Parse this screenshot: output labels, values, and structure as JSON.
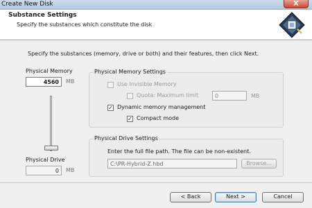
{
  "window": {
    "title": "Create New Disk",
    "close_label": "X"
  },
  "header": {
    "title": "Substance Settings",
    "subtitle": "Specify the substances which constitute the disk",
    "icon": "disk-icon"
  },
  "intro": "Specify the substances (memory, drive or both) and their features, then click Next.",
  "left": {
    "memory_label": "Physical Memory",
    "memory_value": "4560",
    "memory_unit": "MB",
    "drive_label": "Physical Drive",
    "drive_value": "0",
    "drive_unit": "MB"
  },
  "memory_settings": {
    "title": "Physical Memory Settings",
    "use_invisible": {
      "label": "Use Invisible Memory",
      "checked": false,
      "enabled": false
    },
    "quota": {
      "label": "Quota: Maximum limit",
      "checked": false,
      "enabled": false,
      "value": "0",
      "unit": "MB"
    },
    "dynamic": {
      "label": "Dynamic memory management",
      "checked": true,
      "enabled": true
    },
    "compact": {
      "label": "Compact mode",
      "checked": true,
      "enabled": true
    }
  },
  "drive_settings": {
    "title": "Physical Drive Settings",
    "hint": "Enter the full file path. The file can be non-existent.",
    "path": "C:\\PR-Hybrid-Z.hbd",
    "browse_label": "Browse..."
  },
  "footer": {
    "back_label": "< Back",
    "next_label": "Next >",
    "cancel_label": "Cancel"
  }
}
